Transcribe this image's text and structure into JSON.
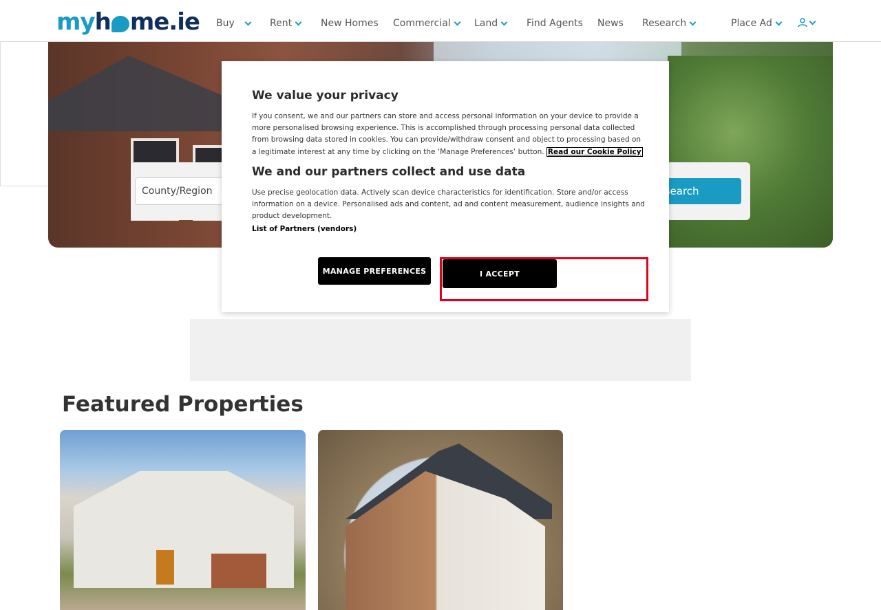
{
  "logo": {
    "text_my": "my",
    "text_h": "h",
    "text_rest": "me.ie"
  },
  "nav": {
    "items": [
      {
        "label": "Buy",
        "has_dropdown": true
      },
      {
        "label": "Rent",
        "has_dropdown": true
      },
      {
        "label": "New Homes",
        "has_dropdown": false
      },
      {
        "label": "Commercial",
        "has_dropdown": true
      },
      {
        "label": "Land",
        "has_dropdown": true
      },
      {
        "label": "Find Agents",
        "has_dropdown": false
      },
      {
        "label": "News",
        "has_dropdown": false
      },
      {
        "label": "Research",
        "has_dropdown": true
      },
      {
        "label": "Place Ad",
        "has_dropdown": true
      }
    ],
    "user_icon": "user-icon"
  },
  "search": {
    "county_label": "County/Region",
    "button_label": "Search"
  },
  "featured": {
    "title": "Featured Properties"
  },
  "modal": {
    "title1": "We value your privacy",
    "body1": "If you consent, we and our partners can store and access personal information on your device to provide a more personalised browsing experience. This is accomplished through processing personal data collected from browsing data stored in cookies. You can provide/withdraw consent and object to processing based on a legitimate interest at any time by clicking on the ‘Manage Preferences’ button.",
    "policy_link": "Read our Cookie Policy",
    "title2": "We and our partners collect and use data",
    "body2": "Use precise geolocation data. Actively scan device characteristics for identification. Store and/or access information on a device. Personalised ads and content, ad and content measurement, audience insights and product development.",
    "partners_link": "List of Partners (vendors)",
    "manage_label": "MANAGE PREFERENCES",
    "accept_label": "I ACCEPT"
  },
  "colors": {
    "brand": "#1a9bc4",
    "brand_dark": "#0f2f5c",
    "highlight": "#e3001b"
  }
}
